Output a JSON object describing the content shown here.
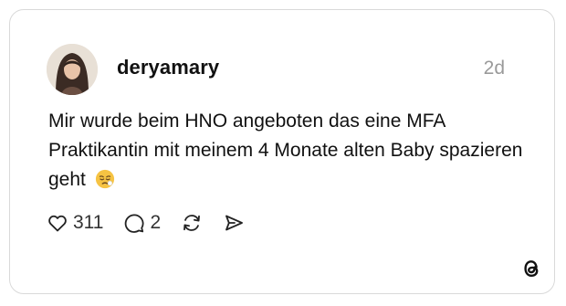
{
  "post": {
    "username": "deryamary",
    "timestamp": "2d",
    "text": "Mir wurde beim HNO angeboten das eine MFA Praktikantin mit meinem 4 Monate alten Baby spazieren geht",
    "emoji": "weary-face-emoji",
    "likes": "311",
    "replies": "2"
  },
  "icons": {
    "like": "heart-outline-icon",
    "reply": "speech-bubble-icon",
    "repost": "repost-arrows-icon",
    "share": "send-arrow-icon",
    "brand": "threads-logo"
  },
  "colors": {
    "text": "#111111",
    "muted": "#9a9a9a",
    "border": "#d9d9d9",
    "emoji": "#f6c343"
  }
}
